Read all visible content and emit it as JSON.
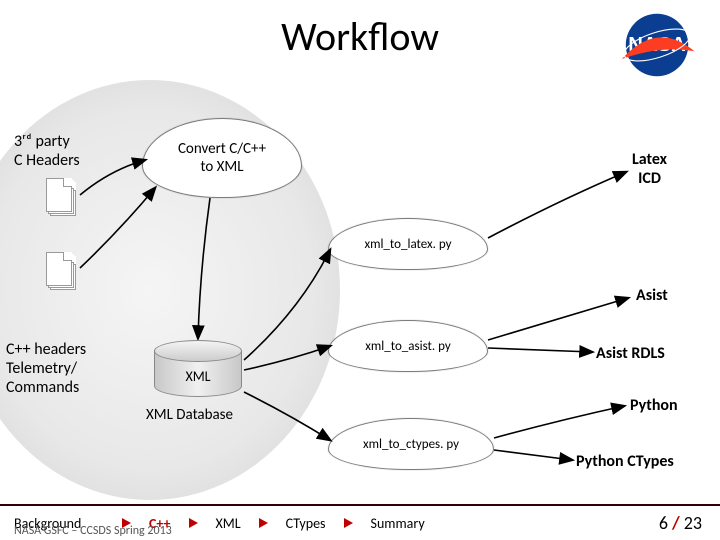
{
  "title": "Workflow",
  "logo_alt": "NASA",
  "nodes": {
    "third_party": "3ʳᵈ party\nC Headers",
    "cpp_headers": "C++ headers\nTelemetry/\nCommands",
    "convert": "Convert C/C++\nto XML",
    "xml_db_cyl": "XML",
    "xml_db_caption": "XML Database",
    "xml_to_latex": "xml_to_latex. py",
    "xml_to_asist": "xml_to_asist. py",
    "xml_to_ctypes": "xml_to_ctypes. py",
    "latex_icd": "Latex\nICD",
    "asist": "Asist",
    "asist_rdls": "Asist RDLS",
    "python": "Python",
    "python_ctypes": "Python CTypes"
  },
  "nav": {
    "items": [
      "Background",
      "C++",
      "XML",
      "CTypes",
      "Summary"
    ],
    "active_index": 1,
    "subtitle": "NASA GSFC – CCSDS Spring 2013",
    "page_current": "6",
    "page_total": "23"
  }
}
